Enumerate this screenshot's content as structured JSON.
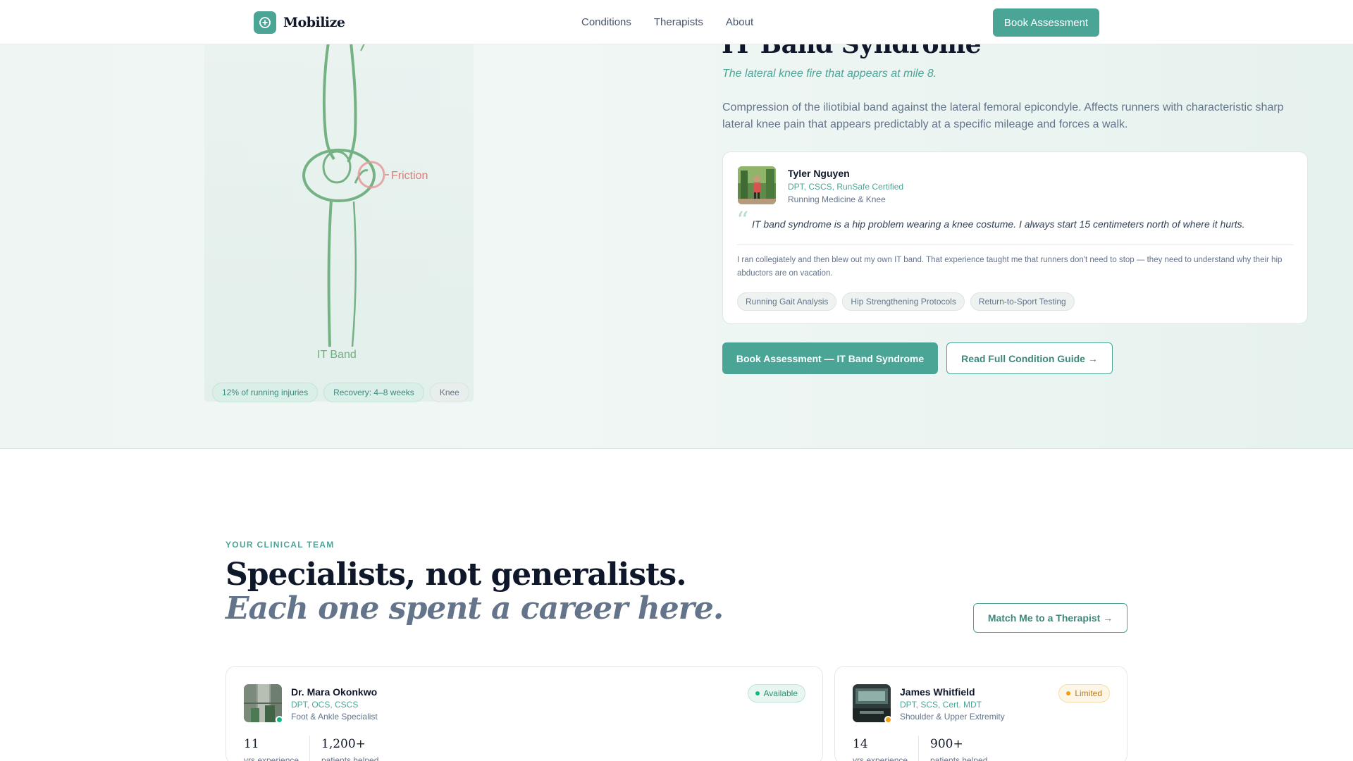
{
  "nav": {
    "brand": "Mobilize",
    "links": [
      "Conditions",
      "Therapists",
      "About"
    ],
    "cta": "Book Assessment"
  },
  "hero": {
    "title": "IT Band Syndrome",
    "subtitle": "The lateral knee fire that appears at mile 8.",
    "description": "Compression of the iliotibial band against the lateral femoral epicondyle. Affects runners with characteristic sharp lateral knee pain that appears predictably at a specific mileage and forces a walk.",
    "illustration": {
      "friction_label": "Friction",
      "band_label": "IT Band"
    },
    "pills": [
      "12% of running injuries",
      "Recovery: 4–8 weeks",
      "Knee"
    ],
    "quote_card": {
      "name": "Tyler Nguyen",
      "credentials": "DPT, CSCS, RunSafe Certified",
      "specialty": "Running Medicine & Knee",
      "quote_mark": "“",
      "quote": "IT band syndrome is a hip problem wearing a knee costume. I always start 15 centimeters north of where it hurts.",
      "body": "I ran collegiately and then blew out my own IT band. That experience taught me that runners don't need to stop — they need to understand why their hip abductors are on vacation.",
      "tags": [
        "Running Gait Analysis",
        "Hip Strengthening Protocols",
        "Return-to-Sport Testing"
      ]
    },
    "primary_button": "Book Assessment — IT Band Syndrome",
    "secondary_button": "Read Full Condition Guide →"
  },
  "team": {
    "eyebrow": "YOUR CLINICAL TEAM",
    "heading": "Specialists, not generalists.",
    "heading_italic": "Each one spent a career here.",
    "match_button": "Match Me to a Therapist →",
    "therapists": [
      {
        "name": "Dr. Mara Okonkwo",
        "credentials": "DPT, OCS, CSCS",
        "specialty": "Foot & Ankle Specialist",
        "status": "Available",
        "status_color": "#10b981",
        "years": "11",
        "years_label": "yrs experience",
        "patients": "1,200+",
        "patients_label": "patients helped"
      },
      {
        "name": "James Whitfield",
        "credentials": "DPT, SCS, Cert. MDT",
        "specialty": "Shoulder & Upper Extremity",
        "status": "Limited",
        "status_color": "#f59e0b",
        "years": "14",
        "years_label": "yrs experience",
        "patients": "900+",
        "patients_label": "patients helped"
      }
    ]
  },
  "colors": {
    "accent": "#4aa597",
    "friction": "#e07a7a",
    "band": "#6fae7e"
  }
}
